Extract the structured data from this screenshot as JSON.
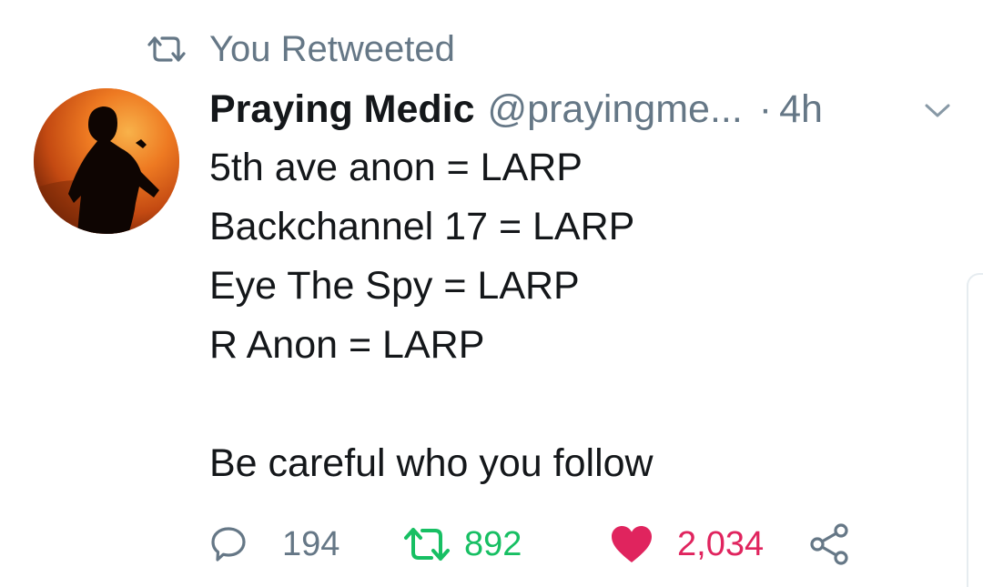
{
  "retweet_context": {
    "label": "You Retweeted",
    "icon": "retweet-icon"
  },
  "tweet": {
    "author": {
      "display_name": "Praying Medic",
      "handle": "@prayingme...",
      "avatar_icon": "silhouette-avatar"
    },
    "separator": "·",
    "time": "4h",
    "menu_icon": "chevron-down-icon",
    "body_lines": [
      "5th ave anon = LARP",
      "Backchannel 17 = LARP",
      "Eye The Spy = LARP",
      "R Anon = LARP",
      "",
      "Be careful who you follow"
    ]
  },
  "actions": {
    "reply": {
      "icon": "reply-icon",
      "count": "194"
    },
    "retweet": {
      "icon": "retweet-icon",
      "count": "892",
      "active": true
    },
    "like": {
      "icon": "heart-icon",
      "count": "2,034",
      "active": true
    },
    "share": {
      "icon": "share-icon"
    }
  },
  "colors": {
    "text": "#14171a",
    "muted": "#657786",
    "retweet_active": "#17bf63",
    "like_active": "#e0245e",
    "avatar_orange": "#e8671c"
  }
}
